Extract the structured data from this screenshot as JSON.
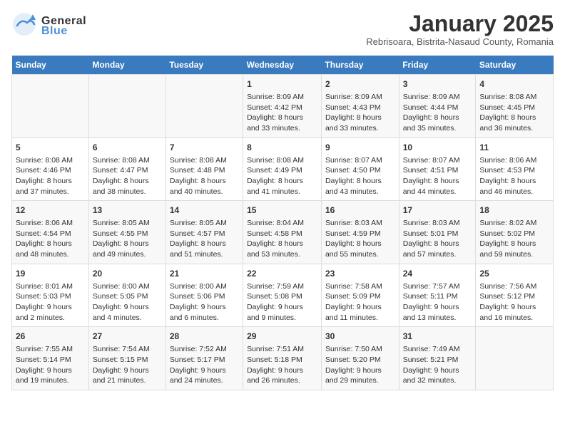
{
  "header": {
    "logo_general": "General",
    "logo_blue": "Blue",
    "title": "January 2025",
    "subtitle": "Rebrisoara, Bistrita-Nasaud County, Romania"
  },
  "days_of_week": [
    "Sunday",
    "Monday",
    "Tuesday",
    "Wednesday",
    "Thursday",
    "Friday",
    "Saturday"
  ],
  "weeks": [
    [
      {
        "day": "",
        "content": ""
      },
      {
        "day": "",
        "content": ""
      },
      {
        "day": "",
        "content": ""
      },
      {
        "day": "1",
        "content": "Sunrise: 8:09 AM\nSunset: 4:42 PM\nDaylight: 8 hours\nand 33 minutes."
      },
      {
        "day": "2",
        "content": "Sunrise: 8:09 AM\nSunset: 4:43 PM\nDaylight: 8 hours\nand 33 minutes."
      },
      {
        "day": "3",
        "content": "Sunrise: 8:09 AM\nSunset: 4:44 PM\nDaylight: 8 hours\nand 35 minutes."
      },
      {
        "day": "4",
        "content": "Sunrise: 8:08 AM\nSunset: 4:45 PM\nDaylight: 8 hours\nand 36 minutes."
      }
    ],
    [
      {
        "day": "5",
        "content": "Sunrise: 8:08 AM\nSunset: 4:46 PM\nDaylight: 8 hours\nand 37 minutes."
      },
      {
        "day": "6",
        "content": "Sunrise: 8:08 AM\nSunset: 4:47 PM\nDaylight: 8 hours\nand 38 minutes."
      },
      {
        "day": "7",
        "content": "Sunrise: 8:08 AM\nSunset: 4:48 PM\nDaylight: 8 hours\nand 40 minutes."
      },
      {
        "day": "8",
        "content": "Sunrise: 8:08 AM\nSunset: 4:49 PM\nDaylight: 8 hours\nand 41 minutes."
      },
      {
        "day": "9",
        "content": "Sunrise: 8:07 AM\nSunset: 4:50 PM\nDaylight: 8 hours\nand 43 minutes."
      },
      {
        "day": "10",
        "content": "Sunrise: 8:07 AM\nSunset: 4:51 PM\nDaylight: 8 hours\nand 44 minutes."
      },
      {
        "day": "11",
        "content": "Sunrise: 8:06 AM\nSunset: 4:53 PM\nDaylight: 8 hours\nand 46 minutes."
      }
    ],
    [
      {
        "day": "12",
        "content": "Sunrise: 8:06 AM\nSunset: 4:54 PM\nDaylight: 8 hours\nand 48 minutes."
      },
      {
        "day": "13",
        "content": "Sunrise: 8:05 AM\nSunset: 4:55 PM\nDaylight: 8 hours\nand 49 minutes."
      },
      {
        "day": "14",
        "content": "Sunrise: 8:05 AM\nSunset: 4:57 PM\nDaylight: 8 hours\nand 51 minutes."
      },
      {
        "day": "15",
        "content": "Sunrise: 8:04 AM\nSunset: 4:58 PM\nDaylight: 8 hours\nand 53 minutes."
      },
      {
        "day": "16",
        "content": "Sunrise: 8:03 AM\nSunset: 4:59 PM\nDaylight: 8 hours\nand 55 minutes."
      },
      {
        "day": "17",
        "content": "Sunrise: 8:03 AM\nSunset: 5:01 PM\nDaylight: 8 hours\nand 57 minutes."
      },
      {
        "day": "18",
        "content": "Sunrise: 8:02 AM\nSunset: 5:02 PM\nDaylight: 8 hours\nand 59 minutes."
      }
    ],
    [
      {
        "day": "19",
        "content": "Sunrise: 8:01 AM\nSunset: 5:03 PM\nDaylight: 9 hours\nand 2 minutes."
      },
      {
        "day": "20",
        "content": "Sunrise: 8:00 AM\nSunset: 5:05 PM\nDaylight: 9 hours\nand 4 minutes."
      },
      {
        "day": "21",
        "content": "Sunrise: 8:00 AM\nSunset: 5:06 PM\nDaylight: 9 hours\nand 6 minutes."
      },
      {
        "day": "22",
        "content": "Sunrise: 7:59 AM\nSunset: 5:08 PM\nDaylight: 9 hours\nand 9 minutes."
      },
      {
        "day": "23",
        "content": "Sunrise: 7:58 AM\nSunset: 5:09 PM\nDaylight: 9 hours\nand 11 minutes."
      },
      {
        "day": "24",
        "content": "Sunrise: 7:57 AM\nSunset: 5:11 PM\nDaylight: 9 hours\nand 13 minutes."
      },
      {
        "day": "25",
        "content": "Sunrise: 7:56 AM\nSunset: 5:12 PM\nDaylight: 9 hours\nand 16 minutes."
      }
    ],
    [
      {
        "day": "26",
        "content": "Sunrise: 7:55 AM\nSunset: 5:14 PM\nDaylight: 9 hours\nand 19 minutes."
      },
      {
        "day": "27",
        "content": "Sunrise: 7:54 AM\nSunset: 5:15 PM\nDaylight: 9 hours\nand 21 minutes."
      },
      {
        "day": "28",
        "content": "Sunrise: 7:52 AM\nSunset: 5:17 PM\nDaylight: 9 hours\nand 24 minutes."
      },
      {
        "day": "29",
        "content": "Sunrise: 7:51 AM\nSunset: 5:18 PM\nDaylight: 9 hours\nand 26 minutes."
      },
      {
        "day": "30",
        "content": "Sunrise: 7:50 AM\nSunset: 5:20 PM\nDaylight: 9 hours\nand 29 minutes."
      },
      {
        "day": "31",
        "content": "Sunrise: 7:49 AM\nSunset: 5:21 PM\nDaylight: 9 hours\nand 32 minutes."
      },
      {
        "day": "",
        "content": ""
      }
    ]
  ]
}
